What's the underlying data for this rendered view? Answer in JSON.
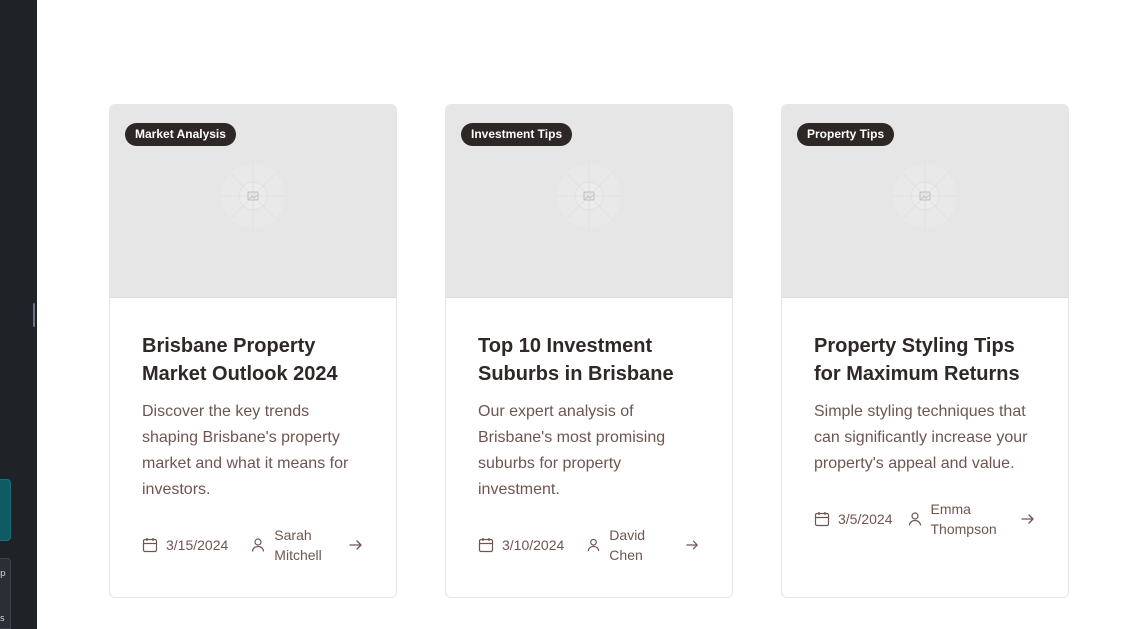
{
  "sidebar": {
    "visible_glyphs": [
      "p",
      "s"
    ]
  },
  "posts": [
    {
      "category": "Market Analysis",
      "title": "Brisbane Property Market Outlook 2024",
      "excerpt": "Discover the key trends shaping Brisbane's property market and what it means for investors.",
      "date": "3/15/2024",
      "author": "Sarah Mitchell"
    },
    {
      "category": "Investment Tips",
      "title": "Top 10 Investment Suburbs in Brisbane",
      "excerpt": "Our expert analysis of Brisbane's most promising suburbs for property investment.",
      "date": "3/10/2024",
      "author": "David Chen"
    },
    {
      "category": "Property Tips",
      "title": "Property Styling Tips for Maximum Returns",
      "excerpt": "Simple styling techniques that can significantly increase your property's appeal and value.",
      "date": "3/5/2024",
      "author": "Emma Thompson"
    }
  ],
  "colors": {
    "badge_bg": "#2d2725",
    "title": "#2e2926",
    "body_text": "#6e5650",
    "image_placeholder": "#e6e6e6",
    "sidebar": "#1f2328",
    "sidebar_accent": "#0f5a63"
  }
}
